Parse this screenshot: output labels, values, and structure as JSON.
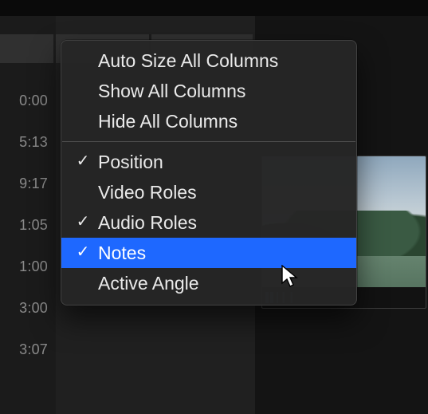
{
  "timecodes": {
    "t0": "0:00",
    "t1": "5:13",
    "t2": "9:17",
    "t3": "1:05",
    "t4": "1:00",
    "t5": "3:00",
    "t6": "3:07"
  },
  "menu": {
    "auto_size": "Auto Size All Columns",
    "show_all": "Show All Columns",
    "hide_all": "Hide All Columns",
    "cols": {
      "position": {
        "label": "Position",
        "checked": true
      },
      "video_roles": {
        "label": "Video Roles",
        "checked": false
      },
      "audio_roles": {
        "label": "Audio Roles",
        "checked": true
      },
      "notes": {
        "label": "Notes",
        "checked": true
      },
      "active_angle": {
        "label": "Active Angle",
        "checked": false
      }
    }
  }
}
